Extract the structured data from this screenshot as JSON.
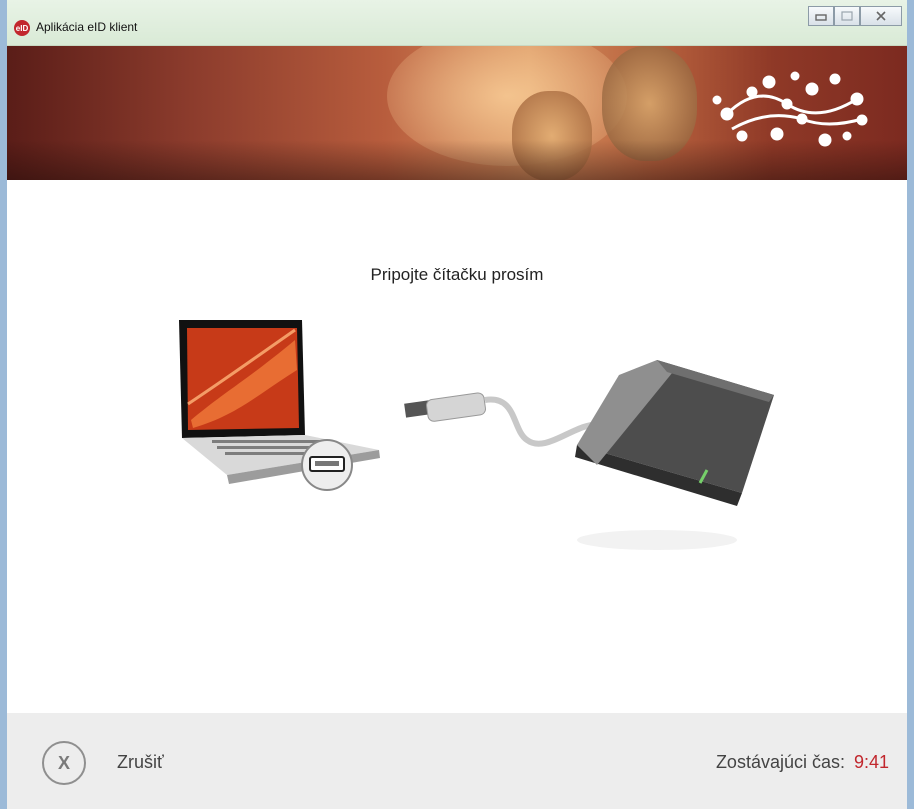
{
  "window": {
    "title": "Aplikácia eID klient",
    "logo_text": "eID",
    "controls": {
      "minimize_icon": "minimize-icon",
      "maximize_icon": "maximize-icon",
      "close_icon": "close-icon"
    }
  },
  "main": {
    "prompt": "Pripojte čítačku prosím",
    "illustration": {
      "laptop_icon": "laptop-with-usb-port",
      "cable_icon": "usb-cable",
      "reader_icon": "card-reader"
    }
  },
  "footer": {
    "cancel_icon_text": "X",
    "cancel_label": "Zrušiť",
    "timer_label": "Zostávajúci čas:",
    "timer_value": "9:41"
  },
  "colors": {
    "accent_red": "#c1272d",
    "footer_bg": "#ededed",
    "banner_brown": "#8b3b2c"
  }
}
